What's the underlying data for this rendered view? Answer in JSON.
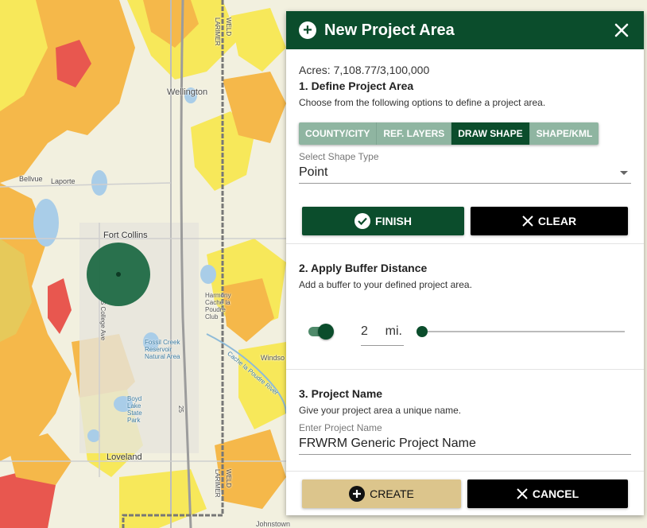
{
  "map": {
    "labels": {
      "wellington": "Wellington",
      "laporte": "Laporte",
      "bellvue": "Bellvue",
      "fort_collins": "Fort Collins",
      "harmony": "Harmony Cache la Poudre Club",
      "fossil_creek": "Fossil Creek Reservoir Natural Area",
      "windsor": "Windso",
      "boyd_lake": "Boyd Lake State Park",
      "loveland": "Loveland",
      "johnstown": "Johnstown",
      "larimer_top": "LARIMER",
      "weld_top": "WELD",
      "larimer_bottom": "LARIMER",
      "weld_bottom": "WELD",
      "college_ave": "S College Ave",
      "cache_river": "Cache la Poudre River",
      "i25": "25"
    },
    "colors": {
      "background": "#f2f0df",
      "orange": "#f5b84a",
      "yellow": "#f7e85a",
      "red": "#e8574f",
      "water": "#a9cde8",
      "buffer": "#1f6a45"
    }
  },
  "panel": {
    "title": "New Project Area",
    "acres": "Acres: 7,108.77/3,100,000",
    "section1": {
      "title": "1. Define Project Area",
      "description": "Choose from the following options to define a project area.",
      "tabs": [
        {
          "label": "COUNTY/CITY",
          "active": false
        },
        {
          "label": "REF. LAYERS",
          "active": false
        },
        {
          "label": "DRAW SHAPE",
          "active": true
        },
        {
          "label": "SHAPE/KML",
          "active": false
        }
      ],
      "shape_type_label": "Select Shape Type",
      "shape_type_value": "Point",
      "finish_label": "FINISH",
      "clear_label": "CLEAR"
    },
    "section2": {
      "title": "2. Apply Buffer Distance",
      "description": "Add a buffer to your defined project area.",
      "toggle_on": true,
      "distance_value": "2",
      "distance_unit": "mi."
    },
    "section3": {
      "title": "3. Project Name",
      "description": "Give your project area a unique name.",
      "name_label": "Enter Project Name",
      "name_value": "FRWRM Generic Project Name"
    },
    "create_label": "CREATE",
    "cancel_label": "CANCEL"
  },
  "colors": {
    "header_green": "#0b4d2c",
    "tab_inactive": "#8fb5a1",
    "create_gold": "#dcc58c"
  }
}
